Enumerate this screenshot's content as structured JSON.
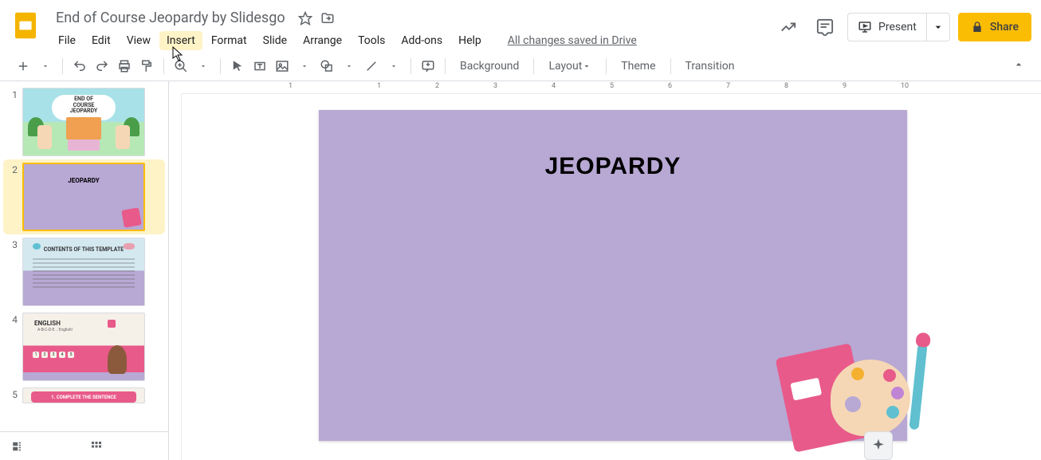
{
  "doc_title": "End of Course Jeopardy by Slidesgo",
  "menus": {
    "file": "File",
    "edit": "Edit",
    "view": "View",
    "insert": "Insert",
    "format": "Format",
    "slide": "Slide",
    "arrange": "Arrange",
    "tools": "Tools",
    "addons": "Add-ons",
    "help": "Help"
  },
  "save_status": "All changes saved in Drive",
  "header_buttons": {
    "present": "Present",
    "share": "Share"
  },
  "toolbar": {
    "background": "Background",
    "layout": "Layout",
    "theme": "Theme",
    "transition": "Transition"
  },
  "ruler_ticks": [
    "1",
    "1",
    "2",
    "3",
    "4",
    "5",
    "6",
    "7",
    "8",
    "9",
    "10"
  ],
  "filmstrip": [
    {
      "num": "1",
      "title": "END OF\nCOURSE\nJEOPARDY"
    },
    {
      "num": "2",
      "title": "JEOPARDY"
    },
    {
      "num": "3",
      "title": "CONTENTS OF THIS TEMPLATE"
    },
    {
      "num": "4",
      "title": "ENGLISH",
      "subtitle": "A-B-C-D-E... English!"
    },
    {
      "num": "5",
      "title": "1. COMPLETE THE SENTENCE"
    }
  ],
  "selected_slide": 2,
  "canvas_slide": {
    "title": "JEOPARDY"
  },
  "colors": {
    "accent": "#fbbc04",
    "slide_bg": "#b8a8d4",
    "pink": "#e85a8a"
  }
}
